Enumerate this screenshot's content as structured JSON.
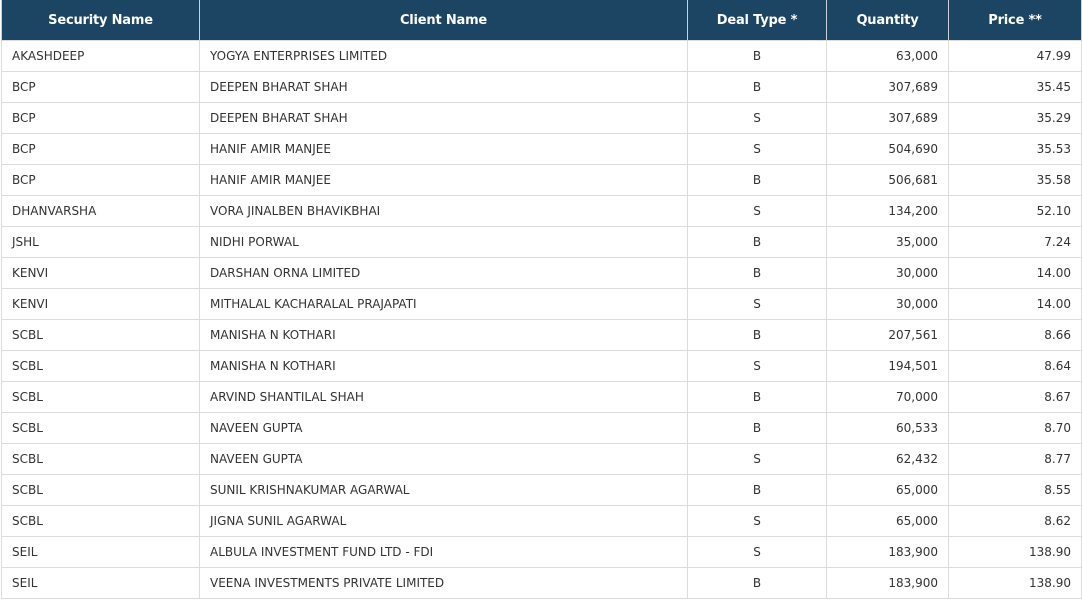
{
  "header": {
    "security_name": "Security Name",
    "client_name": "Client Name",
    "deal_type": "Deal Type *",
    "quantity": "Quantity",
    "price": "Price **"
  },
  "rows": [
    {
      "security": "AKASHDEEP",
      "client": "YOGYA ENTERPRISES LIMITED",
      "deal": "B",
      "qty": "63,000",
      "price": "47.99"
    },
    {
      "security": "BCP",
      "client": "DEEPEN BHARAT SHAH",
      "deal": "B",
      "qty": "307,689",
      "price": "35.45"
    },
    {
      "security": "BCP",
      "client": "DEEPEN BHARAT SHAH",
      "deal": "S",
      "qty": "307,689",
      "price": "35.29"
    },
    {
      "security": "BCP",
      "client": "HANIF AMIR MANJEE",
      "deal": "S",
      "qty": "504,690",
      "price": "35.53"
    },
    {
      "security": "BCP",
      "client": "HANIF AMIR MANJEE",
      "deal": "B",
      "qty": "506,681",
      "price": "35.58"
    },
    {
      "security": "DHANVARSHA",
      "client": "VORA JINALBEN BHAVIKBHAI",
      "deal": "S",
      "qty": "134,200",
      "price": "52.10"
    },
    {
      "security": "JSHL",
      "client": "NIDHI PORWAL",
      "deal": "B",
      "qty": "35,000",
      "price": "7.24"
    },
    {
      "security": "KENVI",
      "client": "DARSHAN ORNA LIMITED",
      "deal": "B",
      "qty": "30,000",
      "price": "14.00"
    },
    {
      "security": "KENVI",
      "client": "MITHALAL KACHARALAL PRAJAPATI",
      "deal": "S",
      "qty": "30,000",
      "price": "14.00"
    },
    {
      "security": "SCBL",
      "client": "MANISHA N KOTHARI",
      "deal": "B",
      "qty": "207,561",
      "price": "8.66"
    },
    {
      "security": "SCBL",
      "client": "MANISHA N KOTHARI",
      "deal": "S",
      "qty": "194,501",
      "price": "8.64"
    },
    {
      "security": "SCBL",
      "client": "ARVIND SHANTILAL SHAH",
      "deal": "B",
      "qty": "70,000",
      "price": "8.67"
    },
    {
      "security": "SCBL",
      "client": "NAVEEN GUPTA",
      "deal": "B",
      "qty": "60,533",
      "price": "8.70"
    },
    {
      "security": "SCBL",
      "client": "NAVEEN GUPTA",
      "deal": "S",
      "qty": "62,432",
      "price": "8.77"
    },
    {
      "security": "SCBL",
      "client": "SUNIL KRISHNAKUMAR AGARWAL",
      "deal": "B",
      "qty": "65,000",
      "price": "8.55"
    },
    {
      "security": "SCBL",
      "client": "JIGNA SUNIL AGARWAL",
      "deal": "S",
      "qty": "65,000",
      "price": "8.62"
    },
    {
      "security": "SEIL",
      "client": "ALBULA INVESTMENT FUND LTD - FDI",
      "deal": "S",
      "qty": "183,900",
      "price": "138.90"
    },
    {
      "security": "SEIL",
      "client": "VEENA INVESTMENTS PRIVATE LIMITED",
      "deal": "B",
      "qty": "183,900",
      "price": "138.90"
    }
  ],
  "colors": {
    "header_bg": "#1c4463",
    "header_text": "#ffffff",
    "grid_line": "#dcdcdc",
    "cell_text": "#333333"
  }
}
